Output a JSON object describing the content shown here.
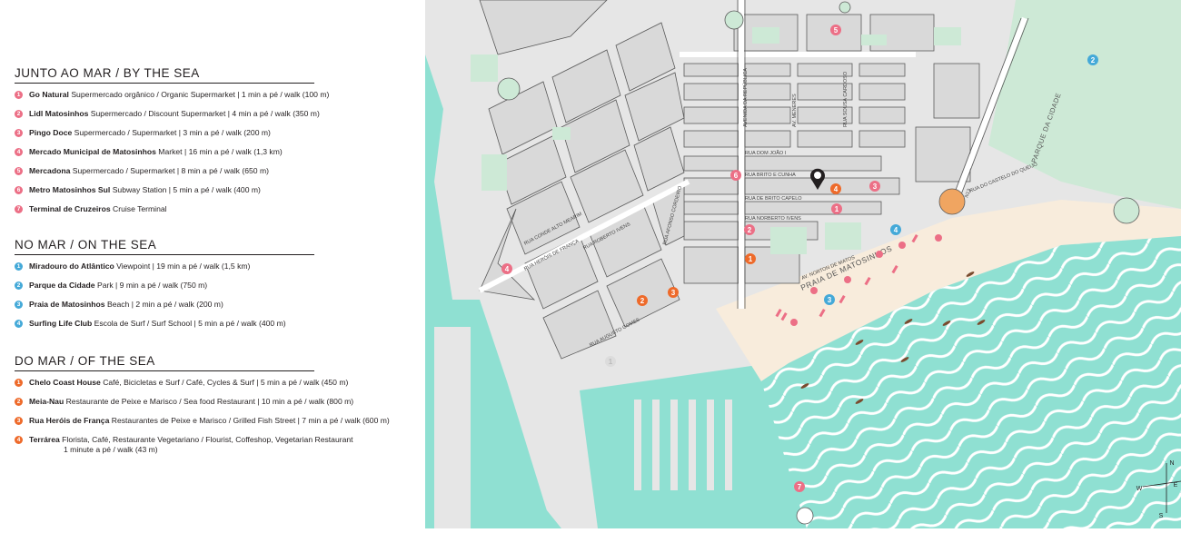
{
  "legend": {
    "sections": [
      {
        "title": "JUNTO AO MAR / BY THE SEA",
        "color": "#ec6f86",
        "items": [
          {
            "num": "1",
            "name": "Go Natural",
            "desc": "Supermercado orgânico / Organic Supermarket | 1 min a pé / walk (100 m)"
          },
          {
            "num": "2",
            "name": "Lidl Matosinhos",
            "desc": "Supermercado / Discount Supermarket | 4 min a pé / walk (350 m)"
          },
          {
            "num": "3",
            "name": "Pingo Doce",
            "desc": "Supermercado / Supermarket | 3 min a pé / walk (200 m)"
          },
          {
            "num": "4",
            "name": "Mercado Municipal de Matosinhos",
            "desc": "Market | 16 min a pé / walk (1,3 km)"
          },
          {
            "num": "5",
            "name": "Mercadona",
            "desc": "Supermercado / Supermarket | 8 min a pé / walk (650 m)"
          },
          {
            "num": "6",
            "name": "Metro Matosinhos Sul",
            "desc": "Subway Station | 5 min a pé / walk (400 m)"
          },
          {
            "num": "7",
            "name": "Terminal de Cruzeiros",
            "desc": "Cruise Terminal"
          }
        ]
      },
      {
        "title": "NO MAR / ON THE SEA",
        "color": "#44a9d8",
        "items": [
          {
            "num": "1",
            "name": "Miradouro do Atlântico",
            "desc": "Viewpoint | 19 min a pé / walk (1,5 km)"
          },
          {
            "num": "2",
            "name": "Parque da Cidade",
            "desc": "Park | 9 min a pé / walk (750 m)"
          },
          {
            "num": "3",
            "name": "Praia de Matosinhos",
            "desc": "Beach | 2 min a pé / walk (200 m)"
          },
          {
            "num": "4",
            "name": "Surfing Life Club",
            "desc": "Escola de Surf / Surf School | 5 min a pé / walk (400 m)"
          }
        ]
      },
      {
        "title": "DO MAR / OF THE SEA",
        "color": "#ee6a2a",
        "items": [
          {
            "num": "1",
            "name": "Chelo Coast House",
            "desc": "Café, Bicicletas e Surf / Café, Cycles & Surf | 5 min a pé / walk (450 m)"
          },
          {
            "num": "2",
            "name": "Meia-Nau",
            "desc": "Restaurante de Peixe e Marisco / Sea food Restaurant | 10 min a pé / walk (800 m)"
          },
          {
            "num": "3",
            "name": "Rua Heróis de França",
            "desc": "Restaurantes de Peixe e Marisco / Grilled Fish Street | 7 min a pé / walk (600 m)"
          },
          {
            "num": "4",
            "name": "Terrárea",
            "desc": "Florista, Café, Restaurante Vegetariano / Flourist, Coffeshop, Vegetarian Restaurant",
            "desc2": "1 minute a pé / walk (43 m)"
          }
        ]
      }
    ]
  },
  "map": {
    "colors": {
      "sea": "#8fe0d2",
      "wave": "#ffffff",
      "beach": "#f8ecdc",
      "park": "#cde9d6",
      "block": "#d6d6d6",
      "street": "#ffffff",
      "outline": "#5a5a5a",
      "pink": "#ec6f86",
      "blue": "#44a9d8",
      "orange": "#ee6a2a"
    },
    "street_labels": {
      "rua_dom_joao": "RUA DOM JOÃO I",
      "rua_brito_cunha": "RUA BRITO E CUNHA",
      "rua_brito_capelo": "RUA DE BRITO CAPELO",
      "rua_norberto": "RUA NORBERTO IVENS",
      "av_menezes": "AV. MENERES",
      "av_republica": "AVENIDA DA REPÚBLICA",
      "rua_sousa_aroso": "RUA SOUSA CARDOSO",
      "av_mar": "AV. NORTON DE MATOS",
      "praia": "PRAIA DE MATOSINHOS",
      "parque": "PARQUE DA CIDADE",
      "n12": "N12",
      "castelo": "RUA DO CASTELO DO QUEIJO",
      "rua_franca": "RUA HERÓIS DE FRANÇA",
      "rua_roberto": "RUA ROBERTO IVENS",
      "rua_conde": "RUA CONDE ALTO MEARIM",
      "rua_augusto": "RUA AUGUSTO GOMES",
      "rua_afonso": "RUA AFONSO CORDEIRO"
    },
    "compass": {
      "n": "N",
      "s": "S",
      "e": "E",
      "w": "W"
    },
    "hotel_icon": "hotel-pin-icon",
    "markers": [
      {
        "cat": "pink",
        "num": "1"
      },
      {
        "cat": "pink",
        "num": "2"
      },
      {
        "cat": "pink",
        "num": "3"
      },
      {
        "cat": "pink",
        "num": "4"
      },
      {
        "cat": "pink",
        "num": "5"
      },
      {
        "cat": "pink",
        "num": "6"
      },
      {
        "cat": "pink",
        "num": "7"
      },
      {
        "cat": "blue",
        "num": "1"
      },
      {
        "cat": "blue",
        "num": "2"
      },
      {
        "cat": "blue",
        "num": "3"
      },
      {
        "cat": "blue",
        "num": "4"
      },
      {
        "cat": "orange",
        "num": "1"
      },
      {
        "cat": "orange",
        "num": "2"
      },
      {
        "cat": "orange",
        "num": "3"
      },
      {
        "cat": "orange",
        "num": "4"
      }
    ]
  }
}
